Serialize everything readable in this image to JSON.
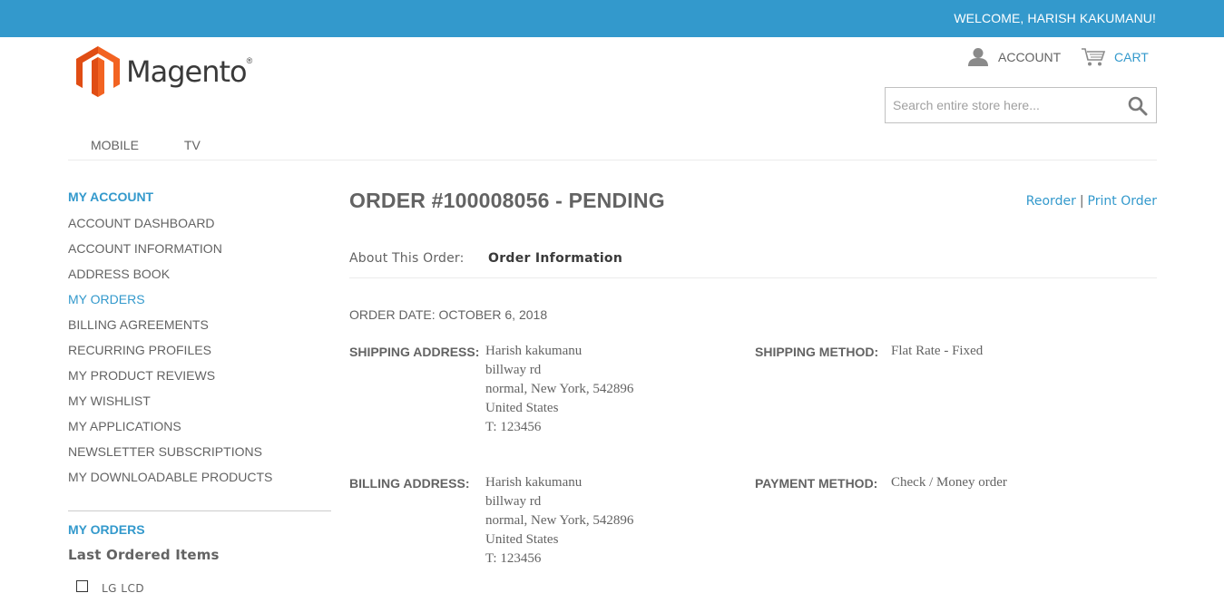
{
  "header": {
    "welcome": "WELCOME, HARISH KAKUMANU!",
    "brand": "Magento",
    "brand_mark": "®",
    "account_label": "ACCOUNT",
    "cart_label": "CART",
    "search_placeholder": "Search entire store here..."
  },
  "nav": {
    "items": [
      "MOBILE",
      "TV"
    ]
  },
  "sidebar": {
    "title": "MY ACCOUNT",
    "items": [
      {
        "label": "ACCOUNT DASHBOARD",
        "active": false
      },
      {
        "label": "ACCOUNT INFORMATION",
        "active": false
      },
      {
        "label": "ADDRESS BOOK",
        "active": false
      },
      {
        "label": "MY ORDERS",
        "active": true
      },
      {
        "label": "BILLING AGREEMENTS",
        "active": false
      },
      {
        "label": "RECURRING PROFILES",
        "active": false
      },
      {
        "label": "MY PRODUCT REVIEWS",
        "active": false
      },
      {
        "label": "MY WISHLIST",
        "active": false
      },
      {
        "label": "MY APPLICATIONS",
        "active": false
      },
      {
        "label": "NEWSLETTER SUBSCRIPTIONS",
        "active": false
      },
      {
        "label": "MY DOWNLOADABLE PRODUCTS",
        "active": false
      }
    ],
    "orders_block_title": "MY ORDERS",
    "last_ordered_title": "Last Ordered Items",
    "last_ordered_items": [
      "LG LCD"
    ]
  },
  "order": {
    "title": "ORDER #100008056 - PENDING",
    "reorder_label": "Reorder",
    "separator": "|",
    "print_label": "Print Order",
    "about_label": "About This Order:",
    "info_tab": "Order Information",
    "date_label": "ORDER DATE: OCTOBER 6, 2018",
    "shipping_address_label": "SHIPPING ADDRESS:",
    "shipping_address": [
      "Harish kakumanu",
      "billway rd",
      "normal, New York, 542896",
      "United States",
      "T: 123456"
    ],
    "shipping_method_label": "SHIPPING METHOD:",
    "shipping_method": "Flat Rate - Fixed",
    "billing_address_label": "BILLING ADDRESS:",
    "billing_address": [
      "Harish kakumanu",
      "billway rd",
      "normal, New York, 542896",
      "United States",
      "T: 123456"
    ],
    "payment_method_label": "PAYMENT METHOD:",
    "payment_method": "Check / Money order"
  },
  "colors": {
    "accent": "#3399cc",
    "text": "#636363",
    "logo_orange": "#f26322"
  },
  "icons": {
    "account": "user-icon",
    "cart": "cart-icon",
    "search": "search-icon",
    "logo": "magento-logo-icon"
  }
}
